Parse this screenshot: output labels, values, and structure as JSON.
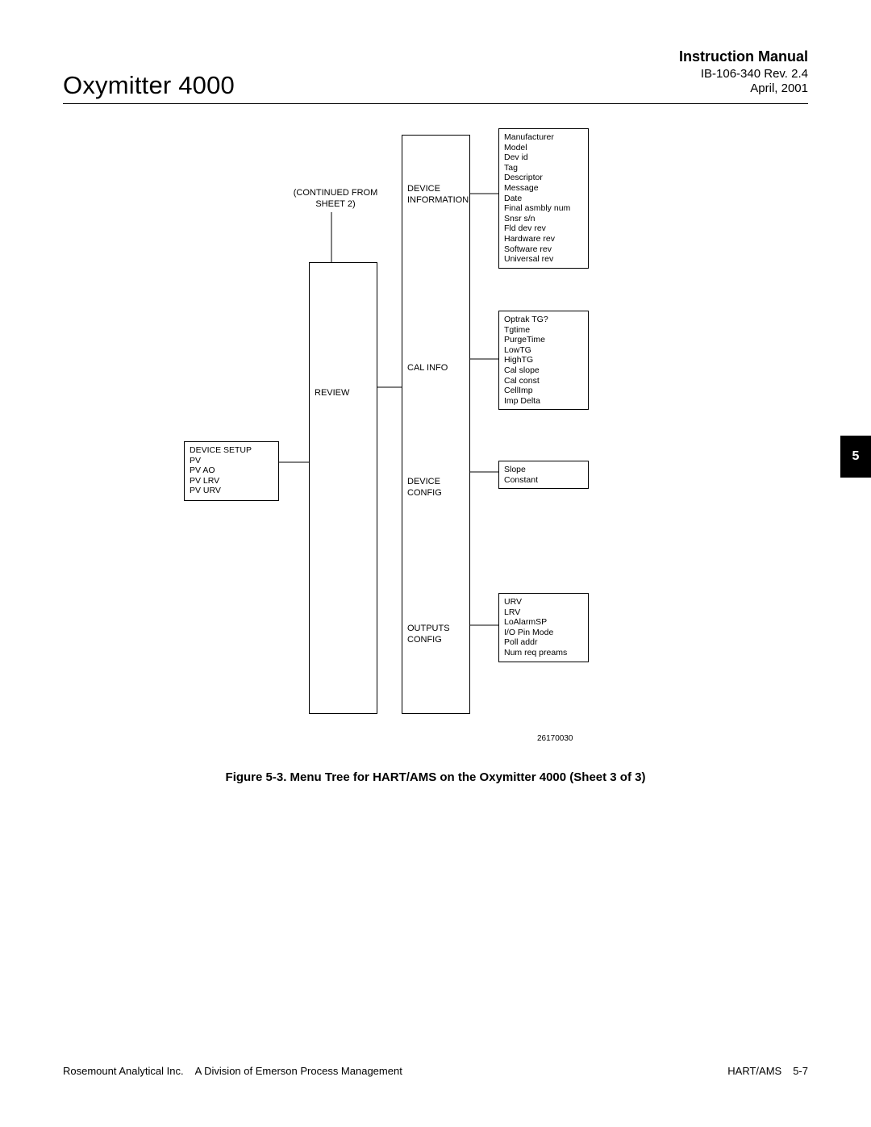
{
  "header": {
    "title_left": "Oxymitter 4000",
    "manual": "Instruction Manual",
    "docnum": "IB-106-340  Rev. 2.4",
    "date": "April, 2001"
  },
  "side_tab": "5",
  "diagram": {
    "continued_from": [
      "(CONTINUED  FROM",
      "SHEET  2)"
    ],
    "level1": {
      "items": [
        "DEVICE  SETUP",
        "PV",
        "PV  AO",
        "PV  LRV",
        "PV  URV"
      ]
    },
    "level2": {
      "label": "REVIEW"
    },
    "level3": {
      "device_info_label": [
        "DEVICE",
        "INFORMATION"
      ],
      "cal_info_label": "CAL  INFO",
      "device_config_label": "DEVICE  CONFIG",
      "outputs_config_label": [
        "OUTPUTS",
        "CONFIG"
      ]
    },
    "level4_device_info": [
      "Manufacturer",
      "Model",
      "Dev id",
      "Tag",
      "Descriptor",
      "Message",
      "Date",
      "Final asmbly num",
      "Snsr s/n",
      "Fld dev rev",
      "Hardware rev",
      "Software rev",
      "Universal rev"
    ],
    "level4_cal_info": [
      "Optrak TG?",
      "Tgtime",
      "PurgeTime",
      "LowTG",
      "HighTG",
      "Cal slope",
      "Cal const",
      "CellImp",
      "Imp Delta"
    ],
    "level4_device_config": [
      "Slope",
      "Constant"
    ],
    "level4_outputs_config": [
      "URV",
      "LRV",
      "LoAlarmSP",
      "I/O Pin Mode",
      "Poll addr",
      "Num req preams"
    ],
    "figure_id": "26170030"
  },
  "caption": "Figure 5-3.  Menu Tree for HART/AMS on the Oxymitter 4000 (Sheet 3 of 3)",
  "footer": {
    "left_company": "Rosemount Analytical Inc.",
    "left_division": "A Division of Emerson Process Management",
    "right_section": "HART/AMS",
    "right_page": "5-7"
  },
  "chart_data": {
    "type": "table",
    "title": "Menu Tree for HART/AMS on the Oxymitter 4000 (Sheet 3 of 3)",
    "tree": {
      "root": {
        "name": "Main",
        "items": [
          "DEVICE SETUP",
          "PV",
          "PV AO",
          "PV LRV",
          "PV URV"
        ],
        "children": [
          {
            "name": "REVIEW",
            "note": "Continued from Sheet 2",
            "children": [
              {
                "name": "DEVICE INFORMATION",
                "items": [
                  "Manufacturer",
                  "Model",
                  "Dev id",
                  "Tag",
                  "Descriptor",
                  "Message",
                  "Date",
                  "Final asmbly num",
                  "Snsr s/n",
                  "Fld dev rev",
                  "Hardware rev",
                  "Software rev",
                  "Universal rev"
                ]
              },
              {
                "name": "CAL INFO",
                "items": [
                  "Optrak TG?",
                  "Tgtime",
                  "PurgeTime",
                  "LowTG",
                  "HighTG",
                  "Cal slope",
                  "Cal const",
                  "CellImp",
                  "Imp Delta"
                ]
              },
              {
                "name": "DEVICE CONFIG",
                "items": [
                  "Slope",
                  "Constant"
                ]
              },
              {
                "name": "OUTPUTS CONFIG",
                "items": [
                  "URV",
                  "LRV",
                  "LoAlarmSP",
                  "I/O Pin Mode",
                  "Poll addr",
                  "Num req preams"
                ]
              }
            ]
          }
        ]
      }
    }
  }
}
